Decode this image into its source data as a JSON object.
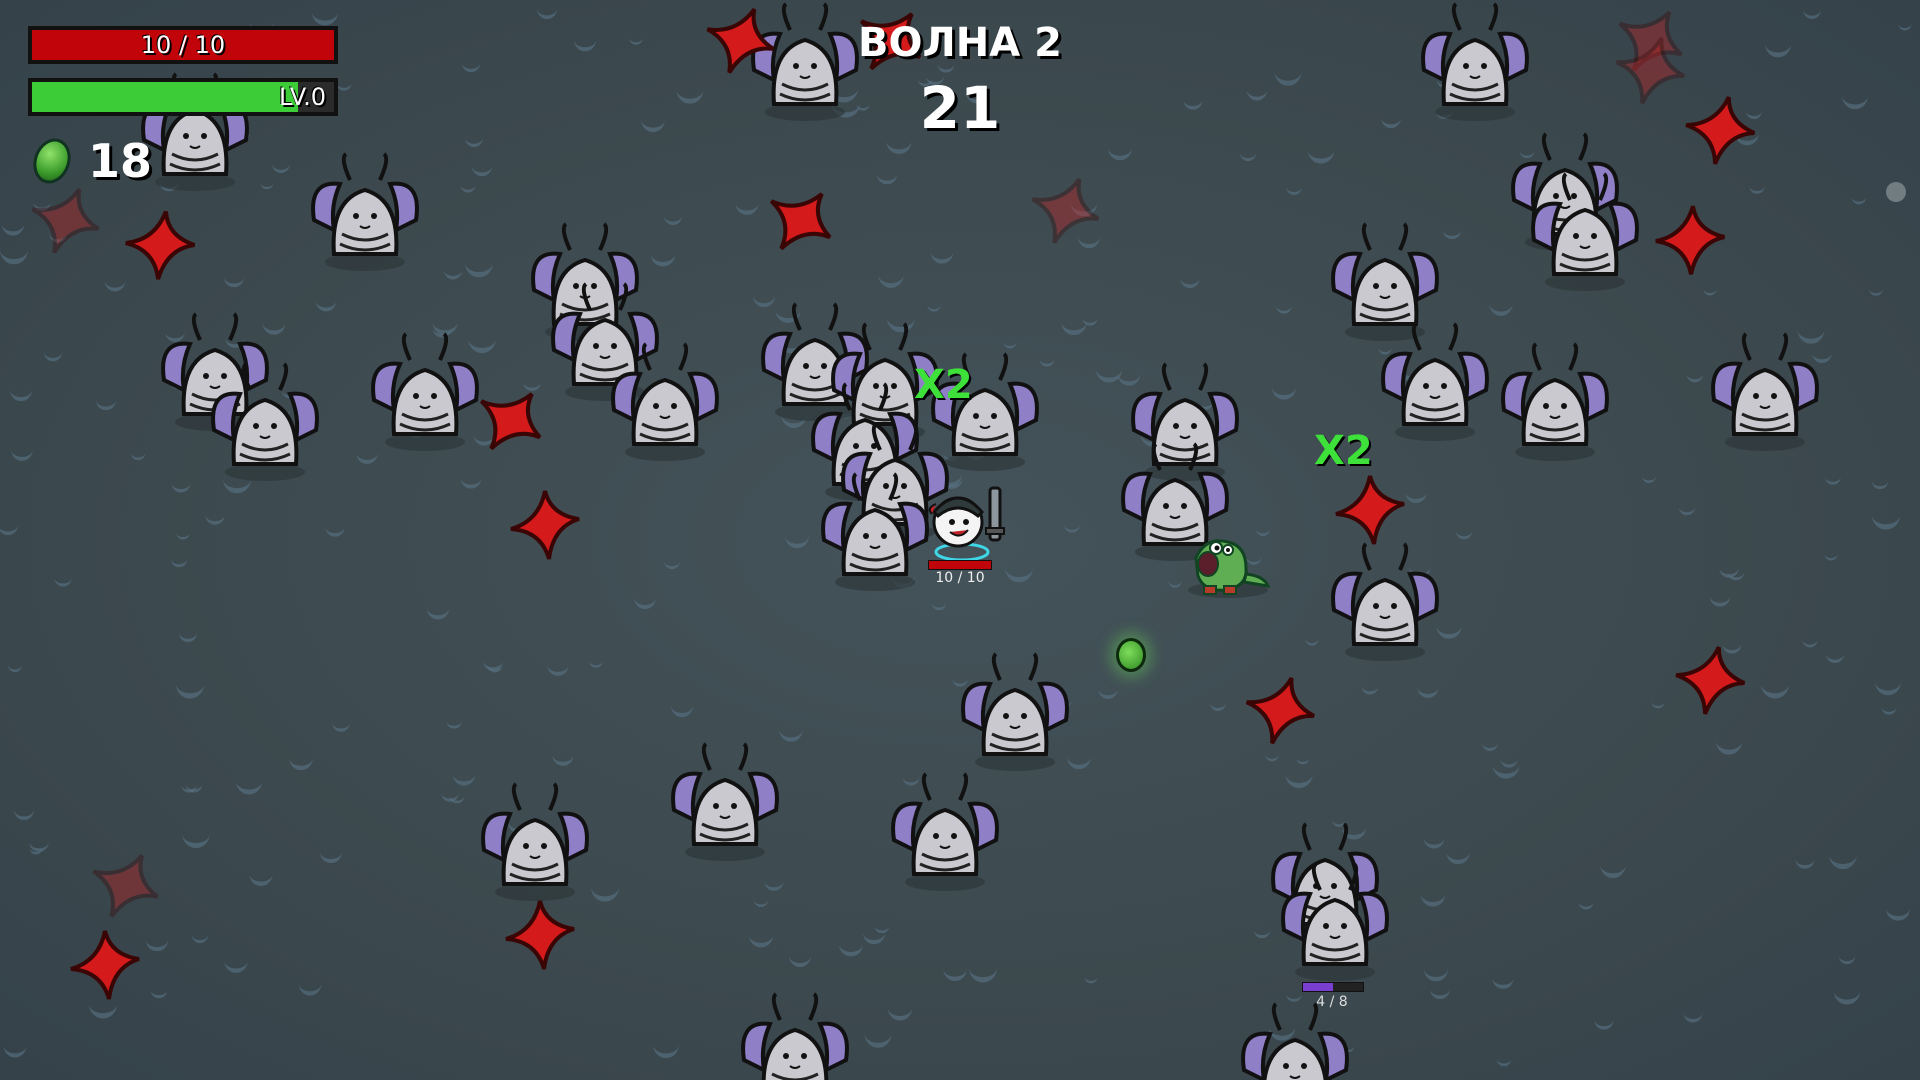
{
  "hud": {
    "hp_text": "10 / 10",
    "hp_fraction": 1.0,
    "level_text": "LV.0",
    "xp_fraction": 0.88,
    "material_count": "18"
  },
  "wave": {
    "title": "ВОЛНА 2",
    "timer": "21"
  },
  "player": {
    "hp_text": "10 / 10"
  },
  "elite": {
    "hp_text": "4 / 8",
    "hp_fraction": 0.5
  },
  "pickups": {
    "multiplier_a": "X2",
    "multiplier_b": "X2"
  },
  "colors": {
    "hp_red": "#c0040a",
    "xp_green": "#3ccc38",
    "enemy_purple": "#8f7fc6",
    "enemy_body": "#c9c9cf",
    "cross_red": "#d41a1a",
    "material_green": "#59c243"
  }
}
